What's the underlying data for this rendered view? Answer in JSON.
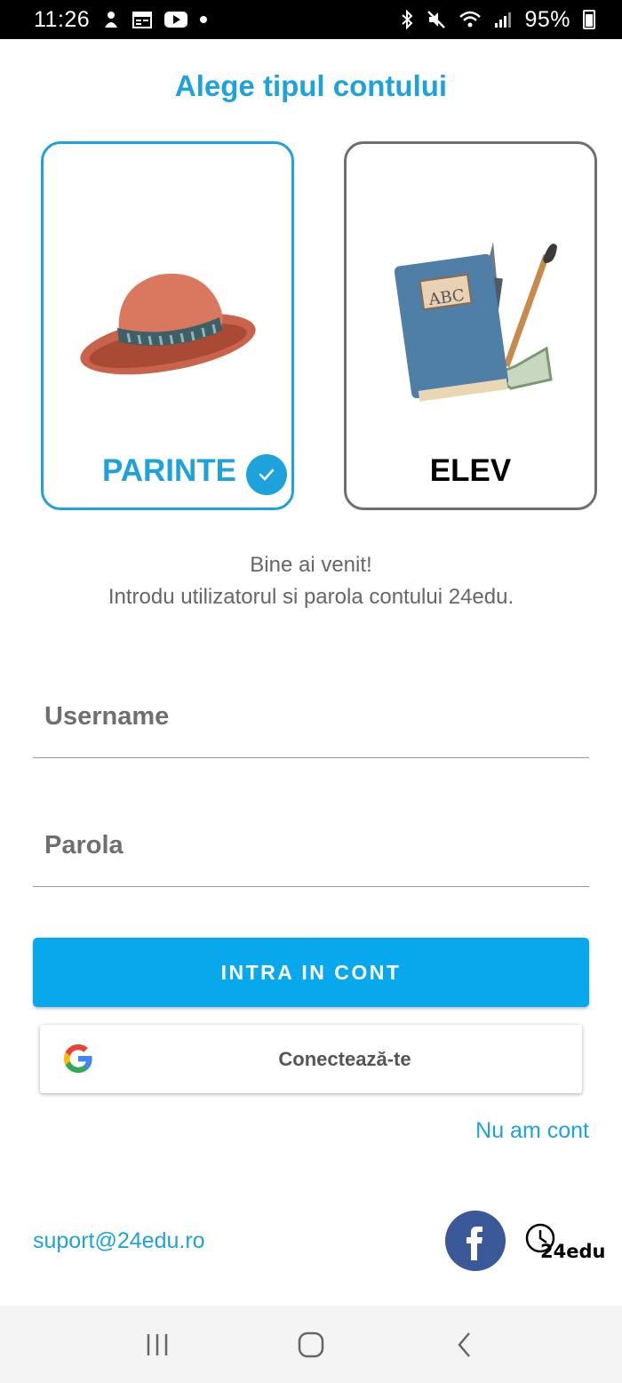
{
  "status_bar": {
    "time": "11:26",
    "battery": "95%"
  },
  "title": "Alege tipul contului",
  "account_types": {
    "parent_label": "PARINTE",
    "student_label": "ELEV",
    "selected": "PARINTE",
    "book_label": "ABC"
  },
  "welcome": {
    "line1": "Bine ai venit!",
    "line2": "Introdu utilizatorul si parola contului 24edu."
  },
  "form": {
    "username_placeholder": "Username",
    "password_placeholder": "Parola",
    "login_label": "INTRA IN CONT",
    "google_label": "Conectează-te"
  },
  "signup_link": "Nu am cont",
  "footer": {
    "support_email": "suport@24edu.ro",
    "brand_text": "24edu"
  },
  "colors": {
    "accent": "#1ea2dc",
    "button": "#08a9ec",
    "facebook": "#3b5998"
  }
}
